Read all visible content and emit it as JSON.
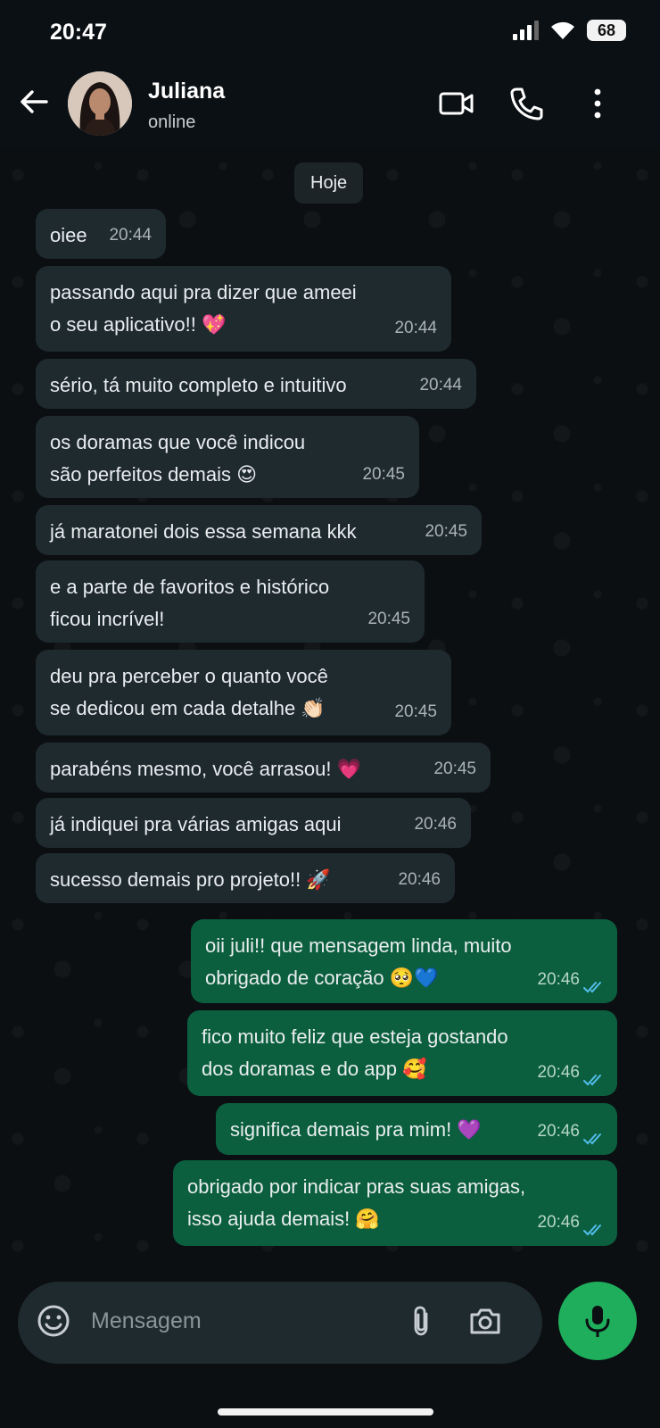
{
  "status_bar": {
    "time": "20:47",
    "battery": "68"
  },
  "header": {
    "contact_name": "Juliana",
    "contact_status": "online"
  },
  "chat": {
    "date_chip": "Hoje",
    "messages": [
      {
        "dir": "in",
        "text": "oiee",
        "time": "20:44"
      },
      {
        "dir": "in",
        "text": "passando aqui pra dizer que ameei\no seu aplicativo!! 💖",
        "time": "20:44"
      },
      {
        "dir": "in",
        "text": "sério, tá muito completo e intuitivo",
        "time": "20:44"
      },
      {
        "dir": "in",
        "text": "os doramas que você indicou\nsão perfeitos demais 😍",
        "time": "20:45"
      },
      {
        "dir": "in",
        "text": "já maratonei dois essa semana kkk",
        "time": "20:45"
      },
      {
        "dir": "in",
        "text": "e a parte de favoritos e histórico\nficou incrível!",
        "time": "20:45"
      },
      {
        "dir": "in",
        "text": "deu pra perceber o quanto você\nse dedicou em cada detalhe 👏🏻",
        "time": "20:45"
      },
      {
        "dir": "in",
        "text": "parabéns mesmo, você arrasou! 💗",
        "time": "20:45"
      },
      {
        "dir": "in",
        "text": "já indiquei pra várias amigas aqui",
        "time": "20:46"
      },
      {
        "dir": "in",
        "text": "sucesso demais pro projeto!! 🚀",
        "time": "20:46"
      },
      {
        "dir": "out",
        "text": "oii juli!! que mensagem linda, muito\nobrigado de coração 🥺💙",
        "time": "20:46"
      },
      {
        "dir": "out",
        "text": "fico muito feliz que esteja gostando\ndos doramas e do app 🥰",
        "time": "20:46"
      },
      {
        "dir": "out",
        "text": "significa demais pra mim! 💜",
        "time": "20:46"
      },
      {
        "dir": "out",
        "text": "obrigado por indicar pras suas amigas,\nisso ajuda demais! 🤗",
        "time": "20:46"
      }
    ]
  },
  "composer": {
    "placeholder": "Mensagem"
  },
  "colors": {
    "accent": "#1fae5c",
    "outgoing_bubble": "#0b5f3e",
    "incoming_bubble": "#1f2a2f",
    "read_ticks": "#53bdeb"
  },
  "icons": {
    "back": "arrow-left-icon",
    "video": "video-call-icon",
    "call": "phone-icon",
    "menu": "more-vert-icon",
    "emoji": "emoji-icon",
    "attach": "paperclip-icon",
    "camera": "camera-icon",
    "mic": "mic-icon"
  }
}
